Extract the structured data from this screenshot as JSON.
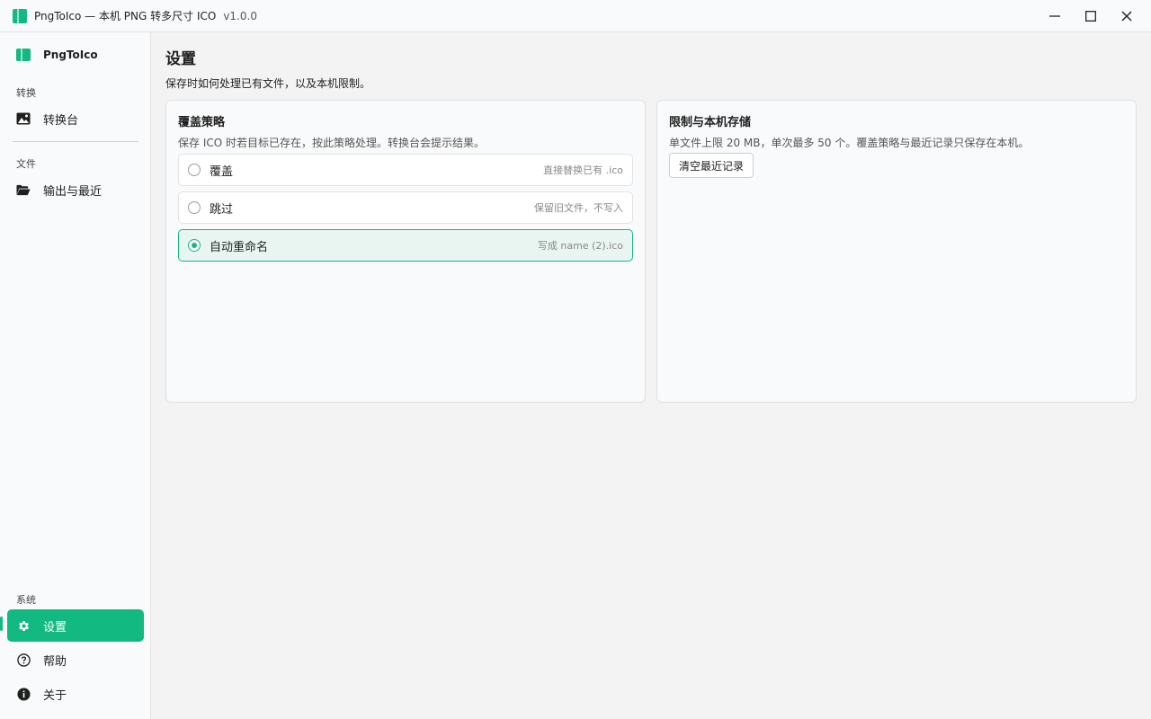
{
  "window": {
    "title": "PngToIco — 本机 PNG 转多尺寸 ICO",
    "version": "v1.0.0"
  },
  "sidebar": {
    "brand": "PngToIco",
    "sections": {
      "convert": "转换",
      "file": "文件",
      "system": "系统"
    },
    "items": {
      "workbench": "转换台",
      "output": "输出与最近",
      "settings": "设置",
      "help": "帮助",
      "about": "关于"
    },
    "active": "settings"
  },
  "page": {
    "title": "设置",
    "subtitle": "保存时如何处理已有文件，以及本机限制。"
  },
  "overwrite_card": {
    "title": "覆盖策略",
    "description": "保存 ICO 时若目标已存在，按此策略处理。转换台会提示结果。",
    "options": [
      {
        "label": "覆盖",
        "hint": "直接替换已有 .ico",
        "selected": false
      },
      {
        "label": "跳过",
        "hint": "保留旧文件，不写入",
        "selected": false
      },
      {
        "label": "自动重命名",
        "hint": "写成 name (2).ico",
        "selected": true
      }
    ]
  },
  "limits_card": {
    "title": "限制与本机存储",
    "description": "单文件上限 20 MB，单次最多 50 个。覆盖策略与最近记录只保存在本机。",
    "clear_button": "清空最近记录"
  },
  "colors": {
    "accent": "#12b981"
  }
}
